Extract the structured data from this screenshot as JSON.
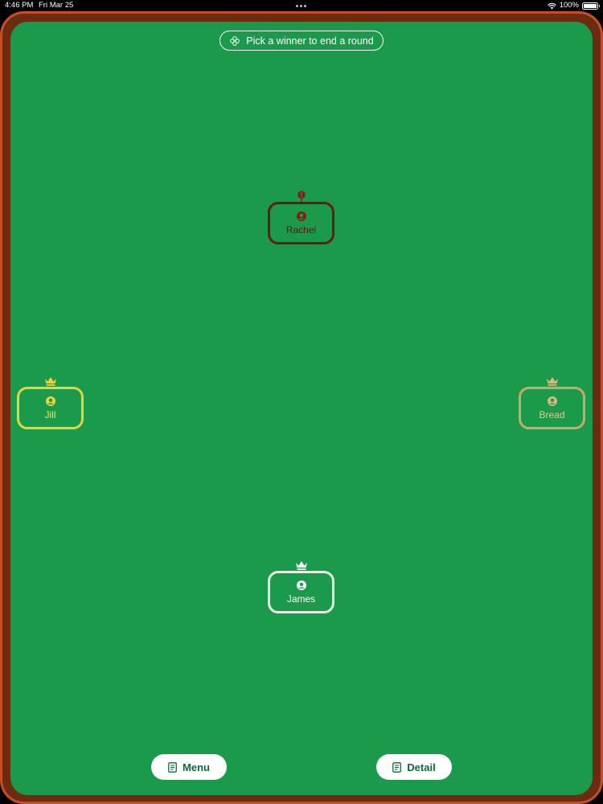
{
  "status_bar": {
    "time": "4:46 PM",
    "date": "Fri Mar 25",
    "battery": "100%"
  },
  "hint": {
    "text": "Pick a winner to end a round",
    "icon": "clover-icon"
  },
  "players": [
    {
      "name": "Rachel",
      "badge": "alert-icon",
      "color": "#6b1a10"
    },
    {
      "name": "Jill",
      "badge": "crown-icon",
      "color": "#e9d23b"
    },
    {
      "name": "Bread",
      "badge": "crown-icon",
      "color": "#c9a96a"
    },
    {
      "name": "James",
      "badge": "crown-icon",
      "color": "#e8eee6"
    }
  ],
  "buttons": {
    "menu": "Menu",
    "detail": "Detail"
  },
  "colors": {
    "felt": "#1c9a4c",
    "frame": "#c64f23",
    "button_text": "#0f6a36"
  }
}
